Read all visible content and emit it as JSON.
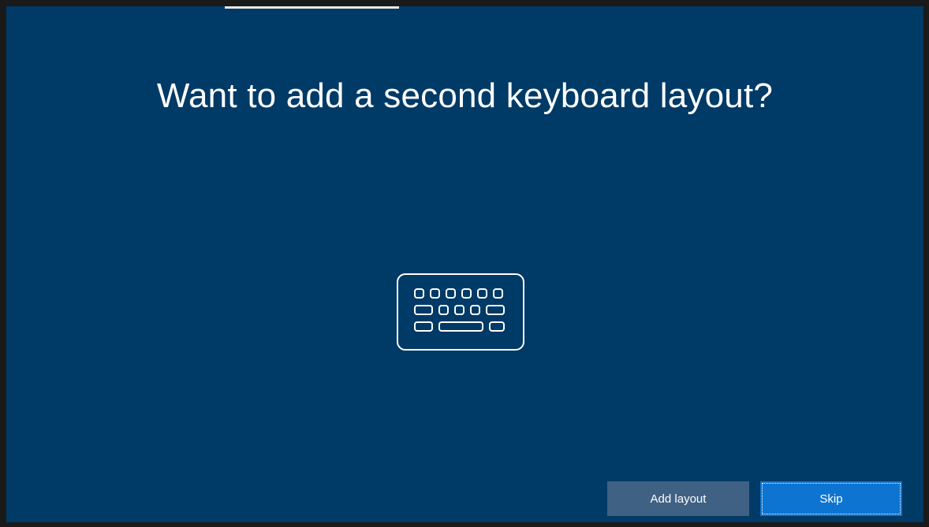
{
  "screen": {
    "title": "Want to add a second keyboard layout?",
    "icon": "keyboard-icon",
    "background_color": "#003a66",
    "progress": {
      "fraction": 0.19
    }
  },
  "buttons": {
    "add_layout_label": "Add layout",
    "skip_label": "Skip",
    "add_layout_color": "#3f6184",
    "skip_color": "#0e74d1"
  }
}
